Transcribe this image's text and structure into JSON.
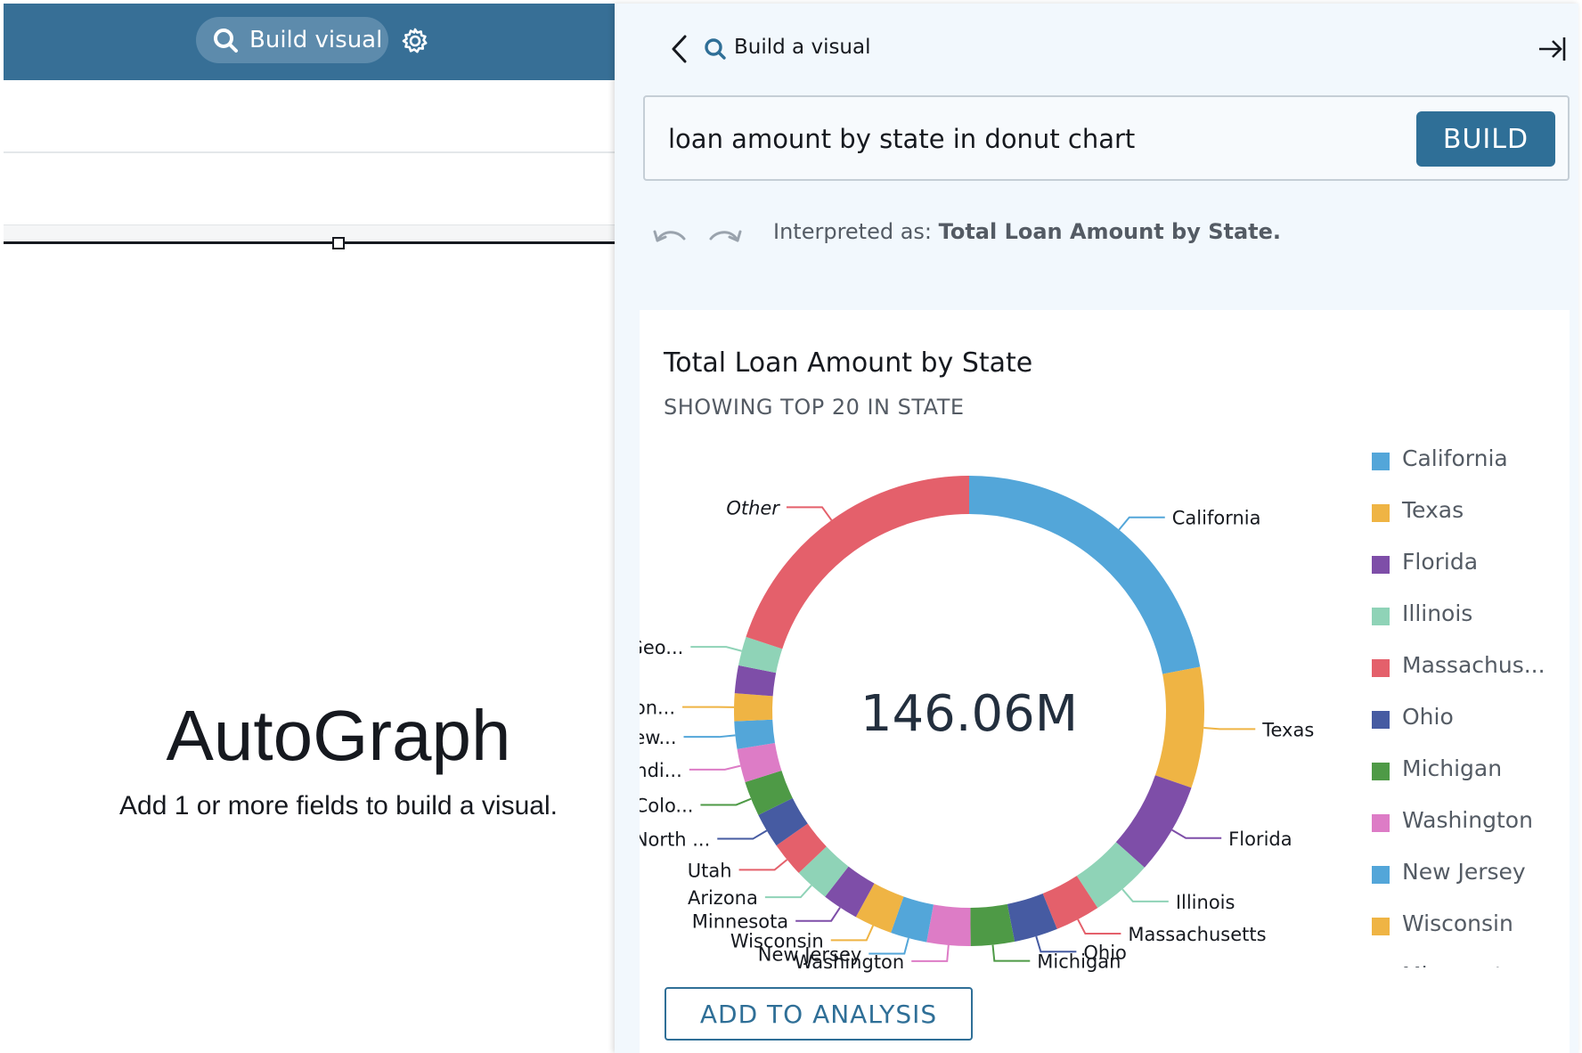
{
  "left": {
    "build_visual_label": "Build visual",
    "autograph_title": "AutoGraph",
    "autograph_subtitle": "Add 1 or more fields to build a visual."
  },
  "panel": {
    "title": "Build a visual",
    "query": "loan amount by state in donut chart",
    "build_label": "BUILD",
    "interpreted_prefix": "Interpreted as: ",
    "interpreted_value": "Total Loan Amount by State.",
    "add_to_analysis_label": "ADD TO ANALYSIS"
  },
  "colors": {
    "header_bar": "#376f96",
    "primary_button": "#2f6f97",
    "panel_background": "#f2f8fd"
  },
  "chart_data": {
    "type": "pie",
    "donut": true,
    "title": "Total Loan Amount by State",
    "subtitle": "SHOWING TOP 20 IN STATE",
    "center_total": "146.06M",
    "legend_position": "right",
    "slices": [
      {
        "label": "California",
        "value": 22.0,
        "color": "#53a6d9"
      },
      {
        "label": "Texas",
        "value": 8.3,
        "color": "#efb444"
      },
      {
        "label": "Florida",
        "value": 6.3,
        "color": "#7e4ea8"
      },
      {
        "label": "Illinois",
        "value": 4.2,
        "color": "#8fd3b7"
      },
      {
        "label": "Massachusetts",
        "value": 3.1,
        "color": "#e4606b"
      },
      {
        "label": "Ohio",
        "value": 3.0,
        "color": "#465ba2"
      },
      {
        "label": "Michigan",
        "value": 3.0,
        "color": "#4e9a46"
      },
      {
        "label": "Washington",
        "value": 3.0,
        "color": "#dd7cc6"
      },
      {
        "label": "New Jersey",
        "value": 2.5,
        "color": "#53a6d9"
      },
      {
        "label": "Wisconsin",
        "value": 2.6,
        "color": "#efb444"
      },
      {
        "label": "Minnesota",
        "value": 2.5,
        "color": "#7e4ea8"
      },
      {
        "label": "Arizona",
        "value": 2.4,
        "color": "#8fd3b7"
      },
      {
        "label": "Utah",
        "value": 2.4,
        "color": "#e4606b"
      },
      {
        "label": "North ...",
        "value": 2.4,
        "color": "#465ba2"
      },
      {
        "label": "Colo...",
        "value": 2.4,
        "color": "#4e9a46"
      },
      {
        "label": "Indi...",
        "value": 2.3,
        "color": "#dd7cc6"
      },
      {
        "label": "New...",
        "value": 1.9,
        "color": "#53a6d9"
      },
      {
        "label": "Con...",
        "value": 1.9,
        "color": "#efb444"
      },
      {
        "label": "",
        "value": 1.9,
        "color": "#7e4ea8"
      },
      {
        "label": "Geo...",
        "value": 2.0,
        "color": "#8fd3b7"
      },
      {
        "label": "Other",
        "value": 19.9,
        "color": "#e4606b",
        "italic": true
      }
    ],
    "legend": [
      {
        "label": "California",
        "color": "#53a6d9"
      },
      {
        "label": "Texas",
        "color": "#efb444"
      },
      {
        "label": "Florida",
        "color": "#7e4ea8"
      },
      {
        "label": "Illinois",
        "color": "#8fd3b7"
      },
      {
        "label": "Massachus...",
        "color": "#e4606b"
      },
      {
        "label": "Ohio",
        "color": "#465ba2"
      },
      {
        "label": "Michigan",
        "color": "#4e9a46"
      },
      {
        "label": "Washington",
        "color": "#dd7cc6"
      },
      {
        "label": "New Jersey",
        "color": "#53a6d9"
      },
      {
        "label": "Wisconsin",
        "color": "#efb444"
      },
      {
        "label": "Minnesota",
        "color": "#7e4ea8"
      }
    ]
  }
}
